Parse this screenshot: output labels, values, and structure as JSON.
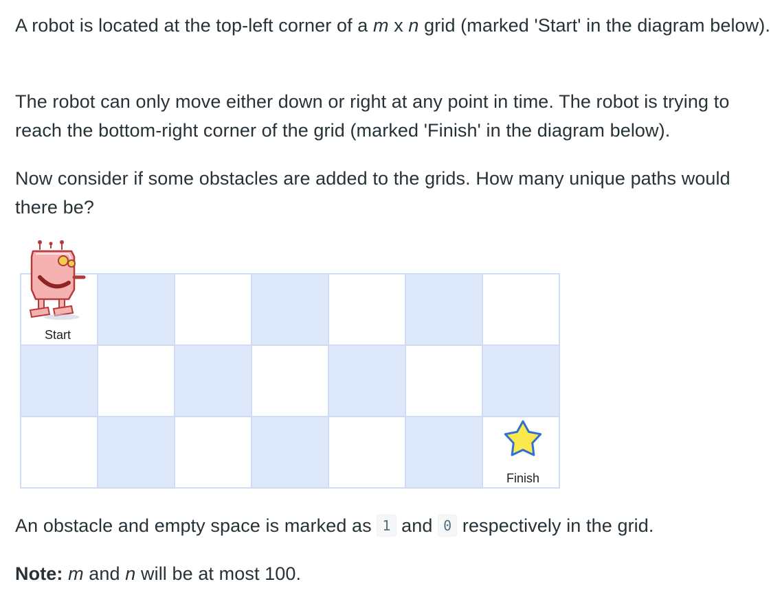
{
  "problem": {
    "p1": {
      "t1": "A robot is located at the top-left corner of a ",
      "m": "m",
      "t2": " x ",
      "n": "n",
      "t3": " grid (marked 'Start' in the diagram below)."
    },
    "p2": "The robot can only move either down or right at any point in time. The robot is trying to reach the bottom-right corner of the grid (marked 'Finish' in the diagram below).",
    "p3": "Now consider if some obstacles are added to the grids. How many unique paths would there be?",
    "p5": {
      "t1": "An obstacle and empty space is marked as ",
      "code1": "1",
      "t2": " and ",
      "code2": "0",
      "t3": " respectively in the grid."
    },
    "p6": {
      "bold": "Note:",
      "m": "m",
      "t1": " and ",
      "n": "n",
      "t2": " will be at most 100."
    }
  },
  "diagram": {
    "rows": 3,
    "cols": 7,
    "start_label": "Start",
    "finish_label": "Finish",
    "colors": {
      "shaded_cell": "#dde8fb",
      "white_cell": "#ffffff",
      "grid_line": "#cfdcf3",
      "robot_body": "#f6b1b1",
      "robot_outline": "#b33a3a",
      "robot_eye": "#f2cf4a",
      "star_fill": "#fbe94b",
      "star_stroke": "#2f6fd6"
    },
    "icons": {
      "start": "robot-icon",
      "finish": "star-icon"
    }
  }
}
